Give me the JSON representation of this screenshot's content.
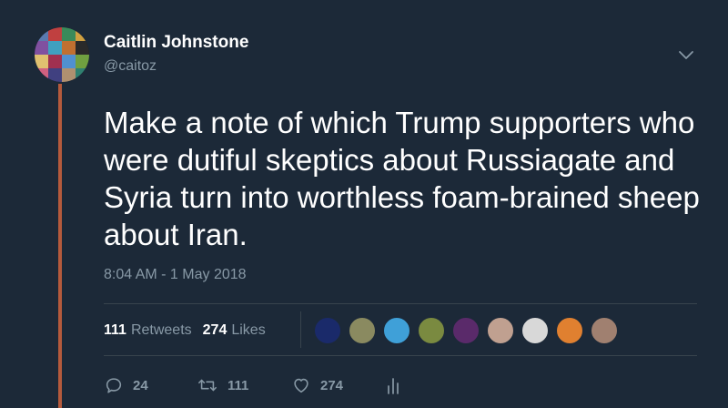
{
  "author": {
    "display_name": "Caitlin Johnstone",
    "handle": "@caitoz",
    "avatar_icon": "mosaic-avatar",
    "avatar_colors": [
      "#5a7ab0",
      "#c04040",
      "#3a8a5a",
      "#d0a040",
      "#8050a0",
      "#40a0c0",
      "#c07030",
      "#2a2a2a",
      "#e0c070",
      "#a03050",
      "#5090d0",
      "#70a040",
      "#d06080",
      "#404080",
      "#b09070",
      "#308070"
    ]
  },
  "menu": {
    "caret_icon": "chevron-down-icon"
  },
  "tweet": {
    "text": "Make a note of which Trump supporters who were dutiful skeptics about Russiagate and Syria turn into worthless foam-brained sheep about Iran.",
    "timestamp": "8:04 AM - 1 May 2018"
  },
  "stats": {
    "retweets_count": "111",
    "retweets_label": "Retweets",
    "likes_count": "274",
    "likes_label": "Likes"
  },
  "likers": [
    {
      "name": "liker-avatar-1",
      "color": "#1a2a6a"
    },
    {
      "name": "liker-avatar-2",
      "color": "#8a8a60"
    },
    {
      "name": "liker-avatar-3",
      "color": "#3fa0d8"
    },
    {
      "name": "liker-avatar-4",
      "color": "#7a8a40"
    },
    {
      "name": "liker-avatar-5",
      "color": "#5a2a6a"
    },
    {
      "name": "liker-avatar-6",
      "color": "#c0a090"
    },
    {
      "name": "liker-avatar-7",
      "color": "#d8d8d8"
    },
    {
      "name": "liker-avatar-8",
      "color": "#e08030"
    },
    {
      "name": "liker-avatar-9",
      "color": "#a08070"
    }
  ],
  "actions": {
    "reply_icon": "reply-icon",
    "reply_count": "24",
    "retweet_icon": "retweet-icon",
    "retweet_count": "111",
    "like_icon": "heart-icon",
    "like_count": "274",
    "analytics_icon": "analytics-icon"
  },
  "colors": {
    "background": "#1c2938",
    "thread_line": "#b55a3c",
    "secondary_text": "#8899a6",
    "divider": "#38444d"
  }
}
